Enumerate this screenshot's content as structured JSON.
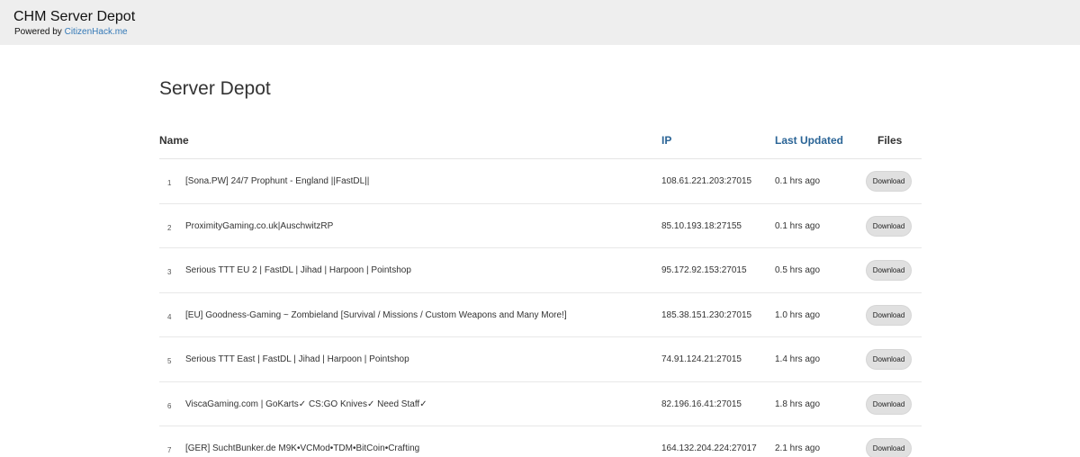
{
  "header": {
    "title": "CHM Server Depot",
    "powered_prefix": "Powered by ",
    "powered_link": "CitizenHack.me"
  },
  "page": {
    "title": "Server Depot"
  },
  "table": {
    "columns": {
      "name": "Name",
      "ip": "IP",
      "updated": "Last Updated",
      "files": "Files"
    },
    "rows": [
      {
        "num": "1",
        "name": "[Sona.PW] 24/7 Prophunt - England ||FastDL||",
        "ip": "108.61.221.203:27015",
        "updated": "0.1 hrs ago",
        "action": "Download"
      },
      {
        "num": "2",
        "name": "ProximityGaming.co.uk|AuschwitzRP",
        "ip": "85.10.193.18:27155",
        "updated": "0.1 hrs ago",
        "action": "Download"
      },
      {
        "num": "3",
        "name": "Serious TTT EU 2 | FastDL | Jihad | Harpoon | Pointshop",
        "ip": "95.172.92.153:27015",
        "updated": "0.5 hrs ago",
        "action": "Download"
      },
      {
        "num": "4",
        "name": "[EU] Goodness-Gaming ~ Zombieland [Survival / Missions / Custom Weapons and Many More!]",
        "ip": "185.38.151.230:27015",
        "updated": "1.0 hrs ago",
        "action": "Download"
      },
      {
        "num": "5",
        "name": "Serious TTT East | FastDL | Jihad | Harpoon | Pointshop",
        "ip": "74.91.124.21:27015",
        "updated": "1.4 hrs ago",
        "action": "Download"
      },
      {
        "num": "6",
        "name": "ViscaGaming.com | GoKarts✓ CS:GO Knives✓ Need Staff✓",
        "ip": "82.196.16.41:27015",
        "updated": "1.8 hrs ago",
        "action": "Download"
      },
      {
        "num": "7",
        "name": "[GER] SuchtBunker.de M9K•VCMod•TDM•BitCoin•Crafting",
        "ip": "164.132.204.224:27017",
        "updated": "2.1 hrs ago",
        "action": "Download"
      }
    ]
  }
}
